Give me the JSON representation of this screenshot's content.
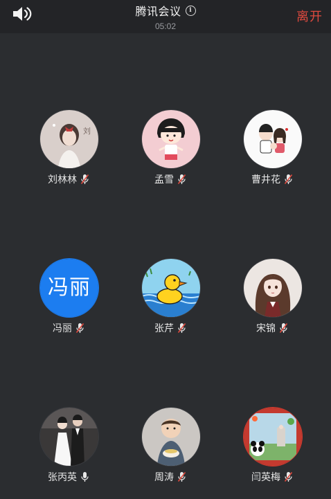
{
  "header": {
    "title": "腾讯会议",
    "timer": "05:02",
    "leave_label": "离开",
    "leave_color": "#e04a3f"
  },
  "participants": [
    {
      "name": "刘林林",
      "mic": "muted",
      "avatar": "girl-with-bow-photo"
    },
    {
      "name": "孟雪",
      "mic": "muted",
      "avatar": "cartoon-girl"
    },
    {
      "name": "曹井花",
      "mic": "muted",
      "avatar": "cartoon-couple"
    },
    {
      "name": "冯丽",
      "mic": "muted",
      "avatar_text": "冯丽",
      "avatar_color": "#1c7df0"
    },
    {
      "name": "张芹",
      "mic": "muted",
      "avatar": "yellow-duck"
    },
    {
      "name": "宋锦",
      "mic": "muted",
      "avatar": "anime-girl"
    },
    {
      "name": "张丙英",
      "mic": "on",
      "avatar": "wedding-photo",
      "host": true
    },
    {
      "name": "周涛",
      "mic": "muted",
      "avatar": "baby-photo"
    },
    {
      "name": "闫英梅",
      "mic": "muted",
      "avatar": "panda-scene"
    }
  ]
}
